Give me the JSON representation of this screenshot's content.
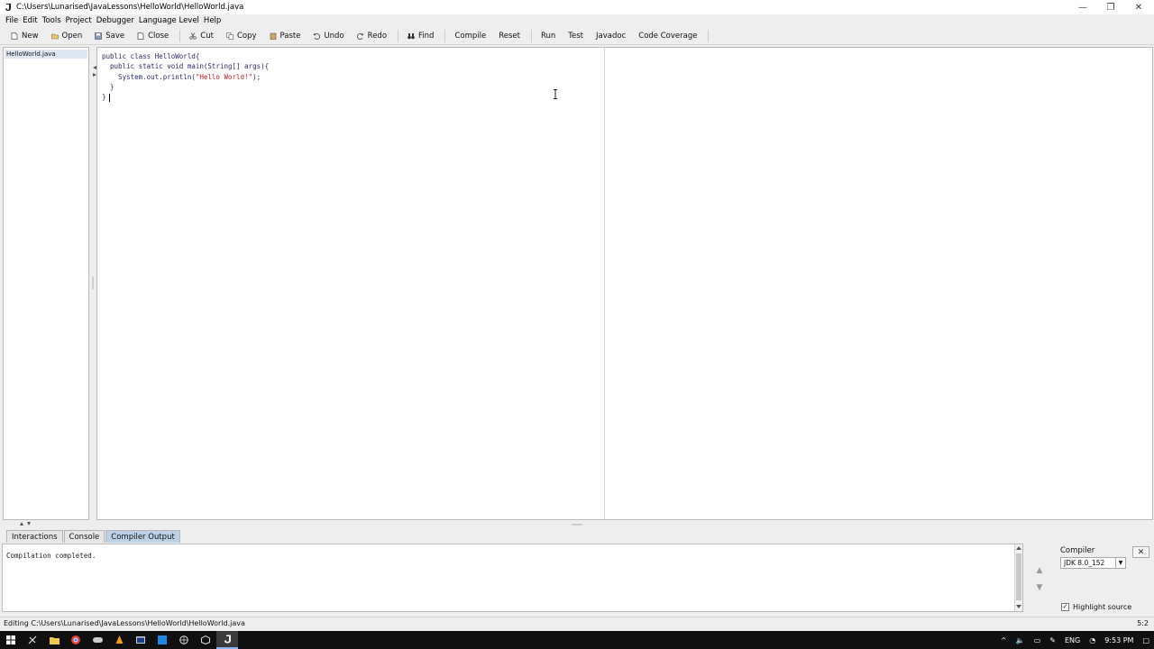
{
  "window": {
    "title": "C:\\Users\\Lunarised\\JavaLessons\\HelloWorld\\HelloWorld.java",
    "controls": {
      "minimize": "—",
      "restore": "❐",
      "close": "✕"
    }
  },
  "menu": [
    "File",
    "Edit",
    "Tools",
    "Project",
    "Debugger",
    "Language Level",
    "Help"
  ],
  "toolbar": {
    "new": "New",
    "open": "Open",
    "save": "Save",
    "close": "Close",
    "cut": "Cut",
    "copy": "Copy",
    "paste": "Paste",
    "undo": "Undo",
    "redo": "Redo",
    "find": "Find",
    "compile": "Compile",
    "reset": "Reset",
    "run": "Run",
    "test": "Test",
    "javadoc": "Javadoc",
    "code_coverage": "Code Coverage"
  },
  "files": [
    "HelloWorld.java"
  ],
  "editor": {
    "lines": [
      "public class HelloWorld{",
      "  public static void main(String[] args){",
      "    System.out.println(",
      "  }",
      "}"
    ],
    "string_literal": "\"Hello World!\"",
    "line3_end": ");"
  },
  "tabs": [
    "Interactions",
    "Console",
    "Compiler Output"
  ],
  "output": {
    "text": "Compilation completed."
  },
  "compiler": {
    "label": "Compiler",
    "selected": "JDK 8.0_152",
    "close": "✕"
  },
  "highlight": {
    "label": "Highlight source",
    "check": "✓"
  },
  "status": {
    "text": "Editing C:\\Users\\Lunarised\\JavaLessons\\HelloWorld\\HelloWorld.java",
    "position": "5:2"
  },
  "nav": {
    "up": "▲",
    "down": "▼"
  },
  "tray": {
    "language": "ENG",
    "time": "9:53 PM"
  },
  "colors": {
    "active_tab": "#bcd0e6",
    "string": "#b22222",
    "code": "#2a2a6e"
  }
}
